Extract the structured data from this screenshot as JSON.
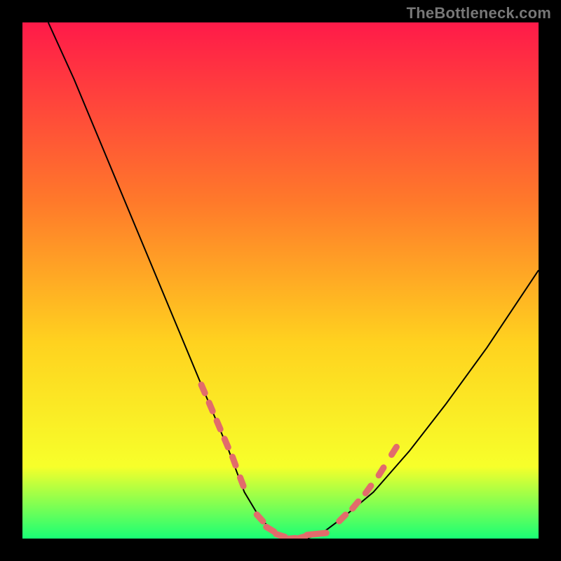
{
  "watermark": "TheBottleneck.com",
  "colors": {
    "frame": "#000000",
    "gradient_top": "#ff1a49",
    "gradient_mid1": "#ff7a2a",
    "gradient_mid2": "#ffd21f",
    "gradient_mid3": "#f7ff2a",
    "gradient_bottom": "#19ff75",
    "curve": "#000000",
    "marker": "#e26b6b"
  },
  "chart_data": {
    "type": "line",
    "title": "",
    "xlabel": "",
    "ylabel": "",
    "xlim": [
      0,
      100
    ],
    "ylim": [
      0,
      100
    ],
    "x": [
      5,
      10,
      15,
      20,
      25,
      30,
      35,
      40,
      43,
      46,
      49,
      52,
      55,
      58,
      62,
      68,
      75,
      82,
      90,
      100
    ],
    "values": [
      100,
      89,
      77,
      65,
      53,
      41,
      29,
      17,
      9,
      4,
      1,
      0,
      0,
      1,
      4,
      9,
      17,
      26,
      37,
      52
    ],
    "marker_segments": [
      {
        "x": [
          35,
          36.5,
          38,
          39.5,
          41,
          42.5
        ],
        "y": [
          29,
          25.5,
          22,
          18.5,
          15,
          11
        ]
      },
      {
        "x": [
          46,
          48,
          50,
          52,
          54,
          56,
          58
        ],
        "y": [
          4,
          1.8,
          0.6,
          0,
          0.2,
          0.8,
          1
        ]
      },
      {
        "x": [
          62,
          64.5,
          67,
          69.5,
          72
        ],
        "y": [
          4,
          6.5,
          9.5,
          13,
          17
        ]
      }
    ],
    "annotations": []
  }
}
